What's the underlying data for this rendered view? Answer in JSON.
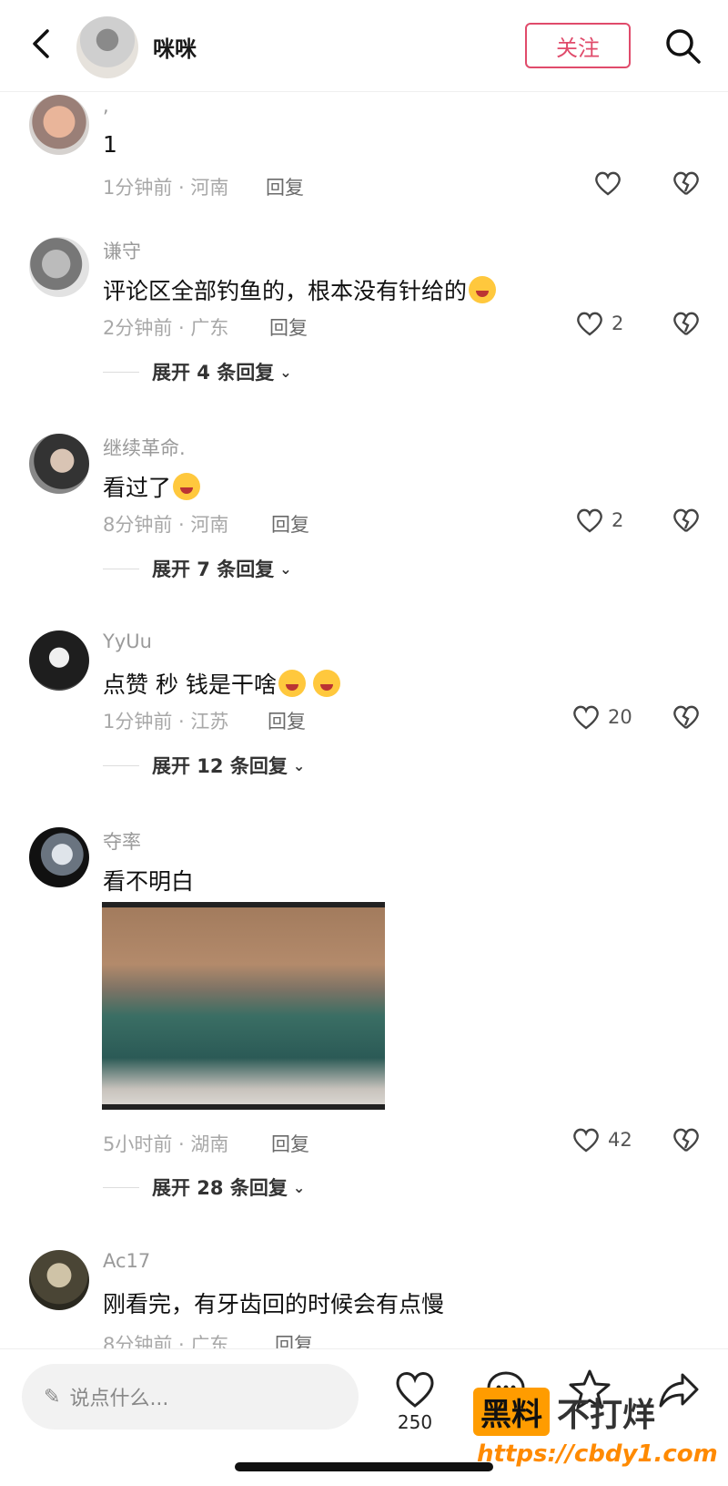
{
  "header": {
    "name": "咪咪",
    "follow_label": "关注"
  },
  "comments": [
    {
      "user": ",",
      "text": "1",
      "time_loc": "1分钟前 · 河南",
      "reply": "回复",
      "likes": "",
      "expand": ""
    },
    {
      "user": "谦守",
      "text": "评论区全部钓鱼的，根本没有针给的",
      "time_loc": "2分钟前 · 广东",
      "reply": "回复",
      "likes": "2",
      "expand": "展开 4 条回复"
    },
    {
      "user": "继续革命.",
      "text": "看过了",
      "time_loc": "8分钟前 · 河南",
      "reply": "回复",
      "likes": "2",
      "expand": "展开 7 条回复"
    },
    {
      "user": "YyUu",
      "text": "点赞 秒  钱是干啥",
      "time_loc": "1分钟前 · 江苏",
      "reply": "回复",
      "likes": "20",
      "expand": "展开 12 条回复"
    },
    {
      "user": "夺率",
      "text": "看不明白",
      "time_loc": "5小时前 · 湖南",
      "reply": "回复",
      "likes": "42",
      "expand": "展开 28 条回复"
    },
    {
      "user": "Ac17",
      "text": "刚看完，有牙齿回的时候会有点慢",
      "time_loc": "8分钟前 · 广东",
      "reply": "回复",
      "likes": "",
      "expand": ""
    }
  ],
  "bottom": {
    "placeholder": "说点什么...",
    "like_count": "250"
  },
  "watermark": {
    "badge": "黑料",
    "text": "不打烊",
    "url": "https://cbdy1.com"
  },
  "colors": {
    "accent": "#e04b6b",
    "watermark": "#ff9c00"
  }
}
